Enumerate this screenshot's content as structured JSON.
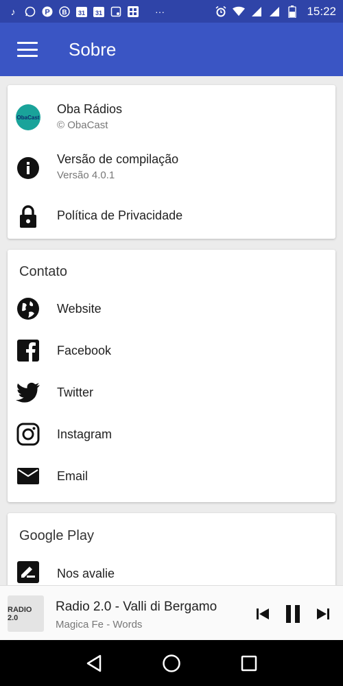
{
  "status_bar": {
    "time": "15:22",
    "left_icons": [
      "music-note-icon",
      "whatsapp-icon",
      "app-p-icon",
      "app-b-icon",
      "calendar-31-icon",
      "calendar-31-icon",
      "app-grid-icon",
      "gallery-icon",
      "more-dots-icon"
    ],
    "right_icons": [
      "alarm-icon",
      "wifi-icon",
      "signal-icon",
      "signal-icon",
      "battery-icon"
    ]
  },
  "app_bar": {
    "title": "Sobre",
    "menu_icon": "hamburger-menu-icon"
  },
  "about_card": {
    "app_name": "Oba Rádios",
    "copyright": "© ObaCast",
    "logo_text": "ObaCast",
    "build_label": "Versão de compilação",
    "build_version": "Versão 4.0.1",
    "privacy_label": "Política de Privacidade"
  },
  "contact_card": {
    "header": "Contato",
    "items": [
      {
        "label": "Website",
        "icon": "globe-icon"
      },
      {
        "label": "Facebook",
        "icon": "facebook-icon"
      },
      {
        "label": "Twitter",
        "icon": "twitter-icon"
      },
      {
        "label": "Instagram",
        "icon": "instagram-icon"
      },
      {
        "label": "Email",
        "icon": "email-icon"
      }
    ]
  },
  "google_play_card": {
    "header": "Google Play",
    "rate_label": "Nos avalie"
  },
  "player": {
    "station": "Radio 2.0 - Valli di Bergamo",
    "track": "Magica Fe - Words",
    "thumb_text": "RADIO 2.0"
  },
  "colors": {
    "primary": "#3a55c4",
    "primary_dark": "#2f44a8"
  }
}
